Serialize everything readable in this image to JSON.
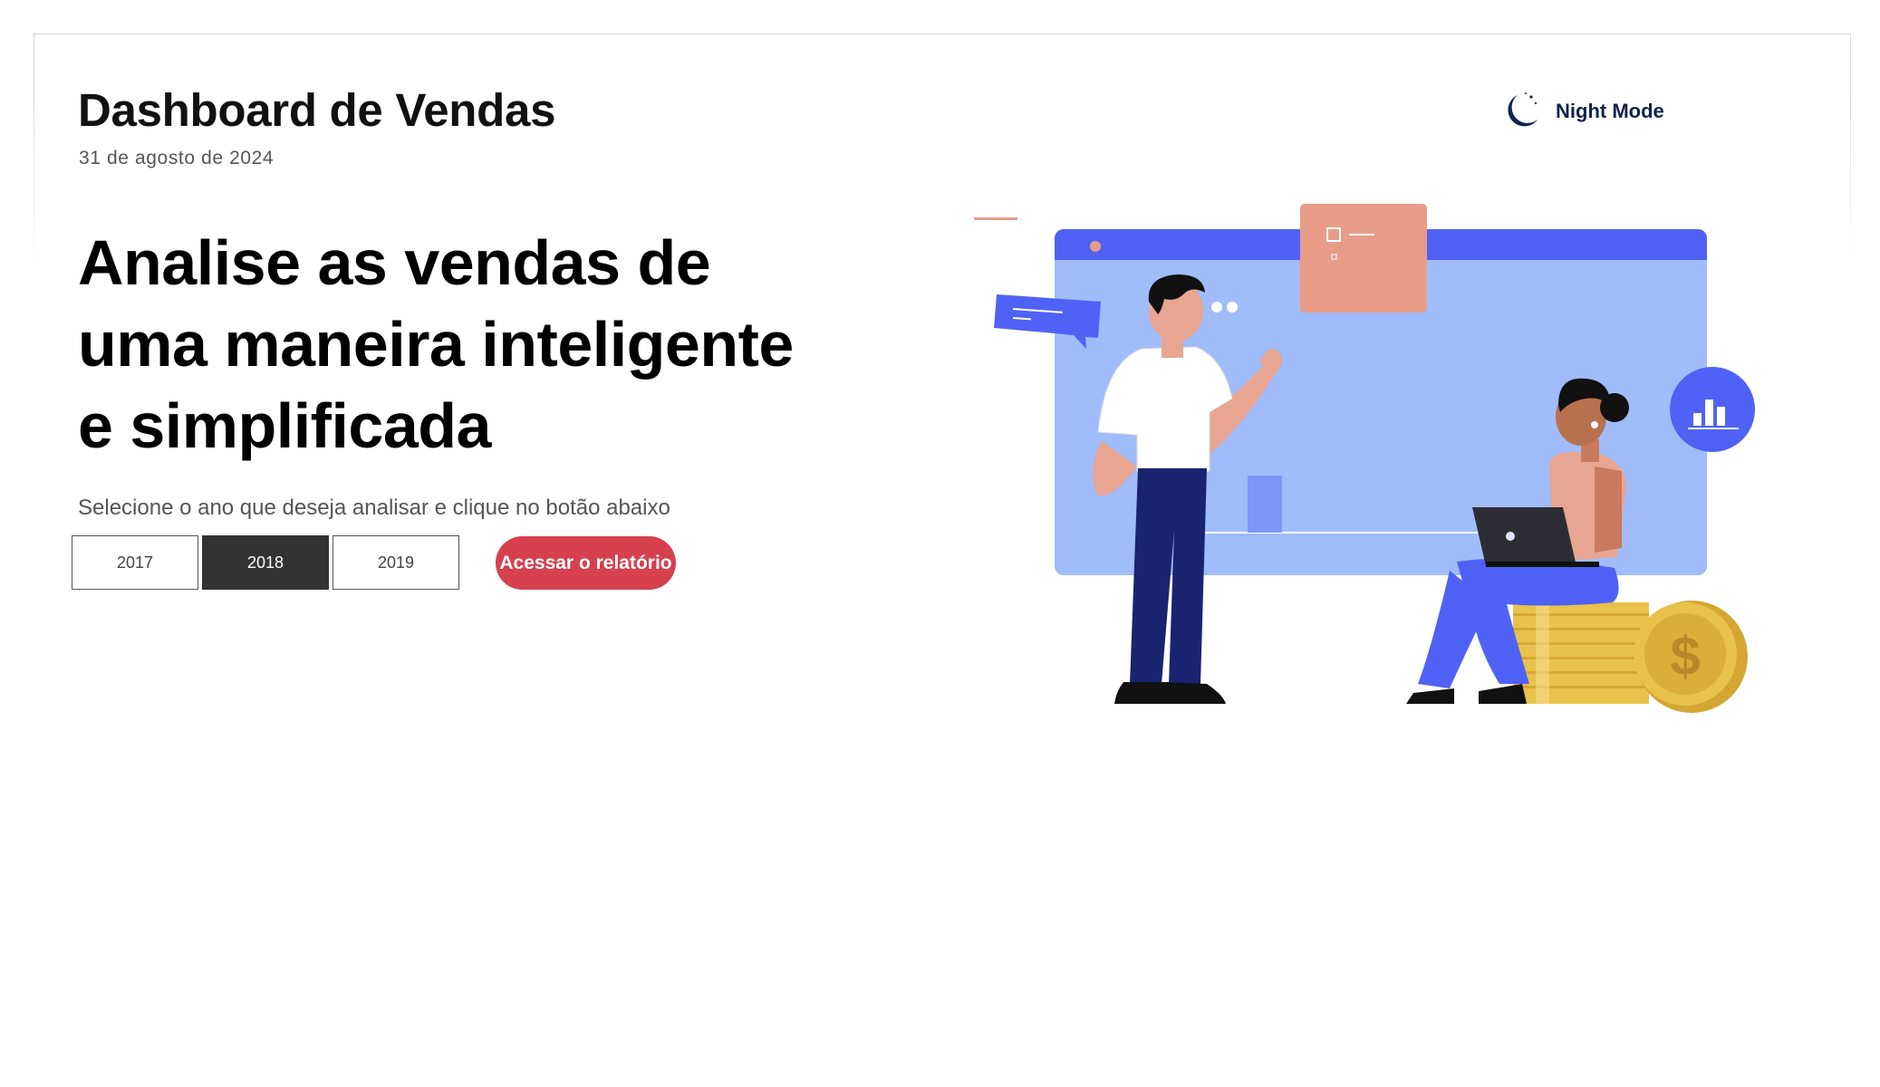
{
  "header": {
    "title": "Dashboard de Vendas",
    "date": "31 de agosto de 2024",
    "night_mode_label": "Night Mode"
  },
  "hero": {
    "lines": [
      "Analise as vendas de",
      "uma maneira inteligente",
      "e simplificada"
    ]
  },
  "selector": {
    "instruction": "Selecione o ano que deseja analisar e clique no botão abaixo",
    "years": [
      "2017",
      "2018",
      "2019"
    ],
    "selected_year": "2018"
  },
  "report_button": {
    "label": "Acessar o relatório"
  },
  "icons": {
    "night_toggle": "moon-icon",
    "illustration": "sales-analytics-illustration"
  },
  "colors": {
    "accent_red": "#d6404f",
    "selected_year_bg": "#333333",
    "night_mode_text": "#13214d",
    "illustration_blue": "#4f62f5",
    "illustration_light_blue": "#a0bcfa",
    "illustration_salmon": "#e89c88",
    "coin_gold": "#e8c24a"
  }
}
